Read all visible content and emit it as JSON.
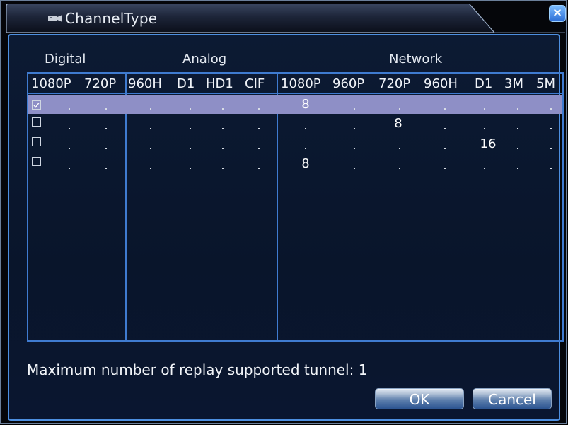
{
  "window": {
    "title": "ChannelType",
    "close_glyph": "×"
  },
  "groups": {
    "digital": "Digital",
    "analog": "Analog",
    "network": "Network"
  },
  "columns": {
    "digital": [
      "1080P",
      "720P"
    ],
    "analog": [
      "960H",
      "D1",
      "HD1",
      "CIF"
    ],
    "network": [
      "1080P",
      "960P",
      "720P",
      "960H",
      "D1",
      "3M",
      "5M"
    ]
  },
  "rows": [
    {
      "checked": true,
      "selected": true,
      "values": {
        "network_1080P": "8"
      }
    },
    {
      "checked": false,
      "selected": false,
      "values": {
        "network_720P": "8"
      }
    },
    {
      "checked": false,
      "selected": false,
      "values": {
        "network_D1": "16"
      }
    },
    {
      "checked": false,
      "selected": false,
      "values": {
        "network_1080P": "8"
      }
    }
  ],
  "info": {
    "text": "Maximum number of replay supported tunnel: 1"
  },
  "buttons": {
    "ok": "OK",
    "cancel": "Cancel"
  },
  "colors": {
    "accent": "#4d8fe0",
    "selection": "#8e8fc6",
    "background": "#09152b"
  },
  "icons": {
    "title": "camera-icon",
    "close": "close-icon",
    "checkbox_checked": "checkmark-icon"
  }
}
